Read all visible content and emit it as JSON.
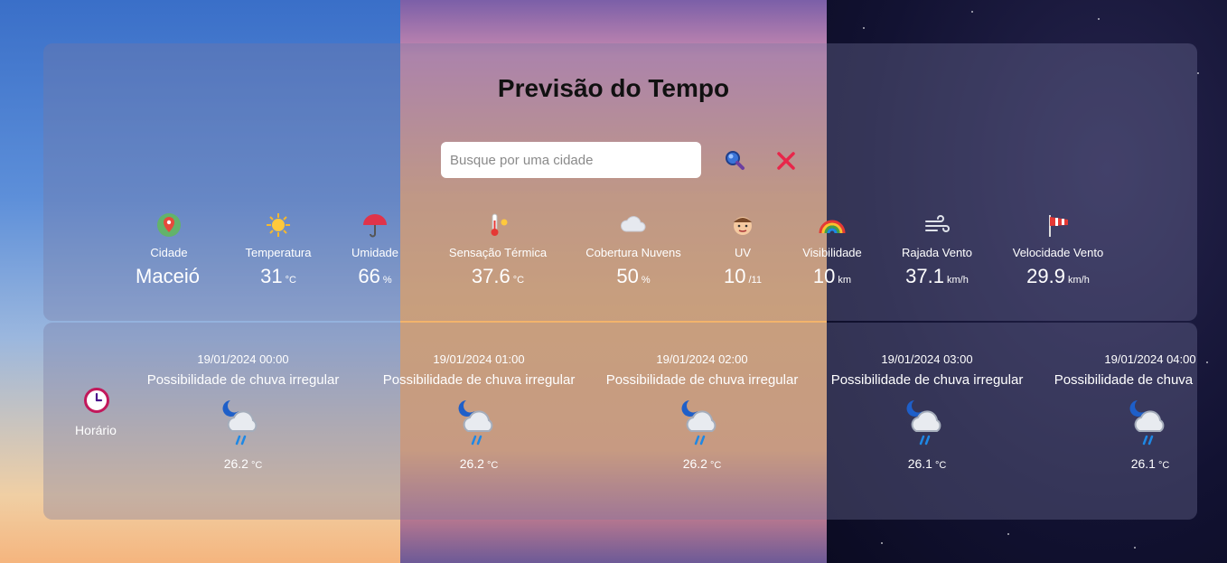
{
  "app": {
    "title": "Previsão do Tempo"
  },
  "search": {
    "placeholder": "Busque por uma cidade",
    "value": ""
  },
  "icons": {
    "search": "search-icon",
    "clear": "close-icon",
    "clock": "clock-icon"
  },
  "metrics": [
    {
      "label": "Cidade",
      "value": "Maceió",
      "unit": "",
      "icon": "map-pin-icon"
    },
    {
      "label": "Temperatura",
      "value": "31",
      "unit": "°C",
      "icon": "sun-icon"
    },
    {
      "label": "Umidade",
      "value": "66",
      "unit": "%",
      "icon": "umbrella-icon"
    },
    {
      "label": "Sensação Térmica",
      "value": "37.6",
      "unit": "°C",
      "icon": "thermometer-icon"
    },
    {
      "label": "Cobertura Nuvens",
      "value": "50",
      "unit": "%",
      "icon": "cloud-icon"
    },
    {
      "label": "UV",
      "value": "10",
      "unit": "/11",
      "icon": "uv-face-icon"
    },
    {
      "label": "Visibilidade",
      "value": "10",
      "unit": "km",
      "icon": "rainbow-icon"
    },
    {
      "label": "Rajada Vento",
      "value": "37.1",
      "unit": "km/h",
      "icon": "wind-icon"
    },
    {
      "label": "Velocidade Vento",
      "value": "29.9",
      "unit": "km/h",
      "icon": "windsock-icon"
    }
  ],
  "hourly": {
    "label": "Horário",
    "items": [
      {
        "datetime": "19/01/2024 00:00",
        "condition": "Possibilidade de chuva irregular",
        "temp": "26.2",
        "unit": "°C",
        "icon": "night-rain-icon"
      },
      {
        "datetime": "19/01/2024 01:00",
        "condition": "Possibilidade de chuva irregular",
        "temp": "26.2",
        "unit": "°C",
        "icon": "night-rain-icon"
      },
      {
        "datetime": "19/01/2024 02:00",
        "condition": "Possibilidade de chuva irregular",
        "temp": "26.2",
        "unit": "°C",
        "icon": "night-rain-icon"
      },
      {
        "datetime": "19/01/2024 03:00",
        "condition": "Possibilidade de chuva irregular",
        "temp": "26.1",
        "unit": "°C",
        "icon": "night-rain-icon"
      },
      {
        "datetime": "19/01/2024 04:00",
        "condition": "Possibilidade de chuva irregular",
        "temp": "26.1",
        "unit": "°C",
        "icon": "night-rain-icon"
      }
    ]
  }
}
